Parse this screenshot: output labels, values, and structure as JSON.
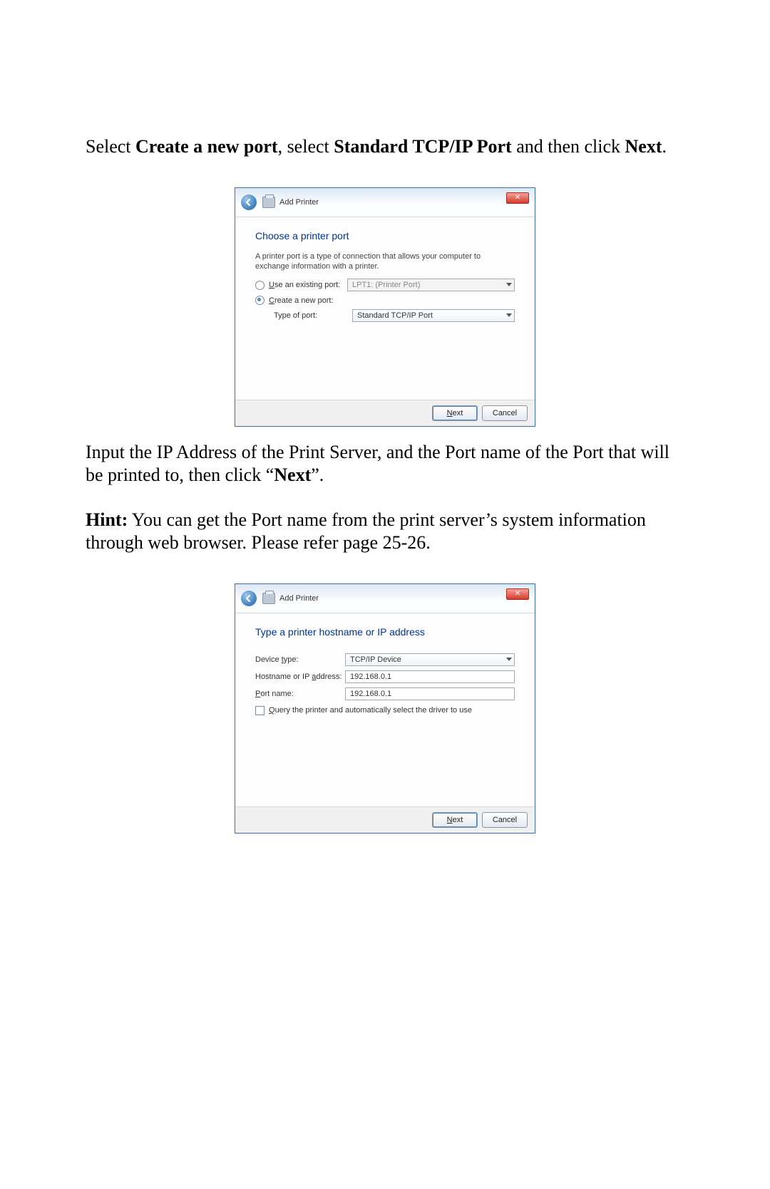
{
  "doc": {
    "p1_lead": "Select ",
    "p1_b1": "Create a new port",
    "p1_mid1": ", select ",
    "p1_b2": "Standard TCP/IP Port",
    "p1_mid2": " and then click ",
    "p1_b3": "Next",
    "p1_end": ".",
    "p2": "Input the IP Address of the Print Server, and the Port name of the Port that will be printed to, then click “",
    "p2_b": "Next",
    "p2_end": "”.",
    "p3_b": "Hint:",
    "p3": " You can get the Port name from the print server’s system information through web browser. Please refer page 25-26."
  },
  "wiz": {
    "title": "Add Printer",
    "close": "✕",
    "next_u": "N",
    "next_rest": "ext",
    "cancel": "Cancel"
  },
  "w1": {
    "heading": "Choose a printer port",
    "desc": "A printer port is a type of connection that allows your computer to exchange information with a printer.",
    "opt_existing_u": "U",
    "opt_existing_rest": "se an existing port:",
    "existing_value": "LPT1: (Printer Port)",
    "opt_create_u": "C",
    "opt_create_rest": "reate a new port:",
    "type_label": "Type of port:",
    "type_value": "Standard TCP/IP Port"
  },
  "w2": {
    "heading": "Type a printer hostname or IP address",
    "device_label_pre": "Device ",
    "device_label_u": "t",
    "device_label_post": "ype:",
    "device_value": "TCP/IP Device",
    "host_label_pre": "Hostname or IP ",
    "host_label_u": "a",
    "host_label_post": "ddress:",
    "host_value": "192.168.0.1",
    "port_label_u": "P",
    "port_label_rest": "ort name:",
    "port_value": "192.168.0.1",
    "query_u": "Q",
    "query_rest": "uery the printer and automatically select the driver to use"
  }
}
